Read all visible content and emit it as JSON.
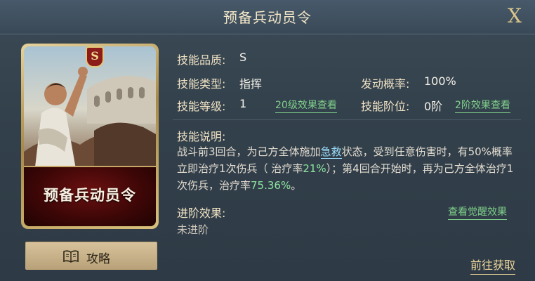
{
  "header": {
    "title": "预备兵动员令",
    "close_label": "X"
  },
  "card": {
    "grade": "S",
    "name": "预备兵动员令",
    "emblem": "☨"
  },
  "guide_button": {
    "label": "攻略",
    "icon": "book-icon"
  },
  "info": {
    "quality_label": "技能品质:",
    "quality_value": "S",
    "type_label": "技能类型:",
    "type_value": "指挥",
    "prob_label": "发动概率:",
    "prob_value": "100%",
    "level_label": "技能等级:",
    "level_value": "1",
    "level_link": "20级效果查看",
    "tier_label": "技能阶位:",
    "tier_value": "0阶",
    "tier_link": "2阶效果查看"
  },
  "description": {
    "label": "技能说明:",
    "seg1": "战斗前3回合，为己方全体施加",
    "keyword": "急救",
    "seg2": "状态，受到任意伤害时，有50%概率立即治疗1次伤兵（ 治疗率",
    "rate1": "21%",
    "seg3": "）；第4回合开始时，再为己方全体治疗1次伤兵，治疗率",
    "rate2": "75.36%",
    "seg4": "。"
  },
  "advance": {
    "label": "进阶效果:",
    "link": "查看觉醒效果",
    "value": "未进阶"
  },
  "go_button": {
    "label": "前往获取"
  },
  "colors": {
    "accent_green": "#7fcf8a",
    "keyword_blue": "#9ee0ff",
    "gold": "#d9c48d",
    "card_band": "#6b1010"
  }
}
